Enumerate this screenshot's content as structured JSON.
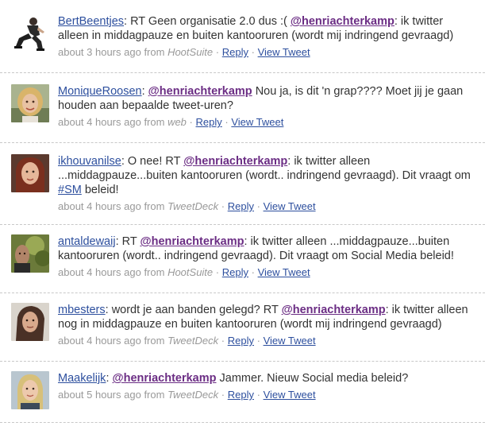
{
  "tweets": [
    {
      "user": "BertBeentjes",
      "text_before": ": RT Geen organisatie 2.0 dus :( ",
      "mention": "@henriachterkamp",
      "text_after": ": ik twitter alleen in middagpauze en buiten kantooruren (wordt mij indringend gevraagd)",
      "time": "about 3 hours ago",
      "from": "from",
      "source": "HootSuite",
      "reply": "Reply",
      "view": "View Tweet",
      "sep": "·"
    },
    {
      "user": "MoniqueRoosen",
      "text_before": ": ",
      "mention": "@henriachterkamp",
      "text_after": " Nou ja, is dit 'n grap???? Moet jij je gaan houden aan bepaalde tweet-uren?",
      "time": "about 4 hours ago",
      "from": "from",
      "source": "web",
      "reply": "Reply",
      "view": "View Tweet",
      "sep": "·"
    },
    {
      "user": "ikhouvanilse",
      "text_before": ": O nee! RT ",
      "mention": "@henriachterkamp",
      "text_after": ": ik twitter alleen ...middagpauze...buiten kantooruren (wordt.. indringend gevraagd). Dit vraagt om ",
      "hashtag": "#SM",
      "text_end": " beleid!",
      "time": "about 4 hours ago",
      "from": "from",
      "source": "TweetDeck",
      "reply": "Reply",
      "view": "View Tweet",
      "sep": "·"
    },
    {
      "user": "antaldewaij",
      "text_before": ": RT ",
      "mention": "@henriachterkamp",
      "text_after": ": ik twitter alleen ...middagpauze...buiten kantooruren (wordt.. indringend gevraagd). Dit vraagt om Social Media beleid!",
      "time": "about 4 hours ago",
      "from": "from",
      "source": "HootSuite",
      "reply": "Reply",
      "view": "View Tweet",
      "sep": "·"
    },
    {
      "user": "mbesters",
      "text_before": ": wordt je aan banden gelegd? RT ",
      "mention": "@henriachterkamp",
      "text_after": ": ik twitter alleen nog in middagpauze en buiten kantooruren (wordt mij indringend gevraagd)",
      "time": "about 4 hours ago",
      "from": "from",
      "source": "TweetDeck",
      "reply": "Reply",
      "view": "View Tweet",
      "sep": "·"
    },
    {
      "user": "Maakelijk",
      "text_before": ": ",
      "mention": "@henriachterkamp",
      "text_after": " Jammer. Nieuw Social media beleid?",
      "time": "about 5 hours ago",
      "from": "from",
      "source": "TweetDeck",
      "reply": "Reply",
      "view": "View Tweet",
      "sep": "·"
    }
  ]
}
